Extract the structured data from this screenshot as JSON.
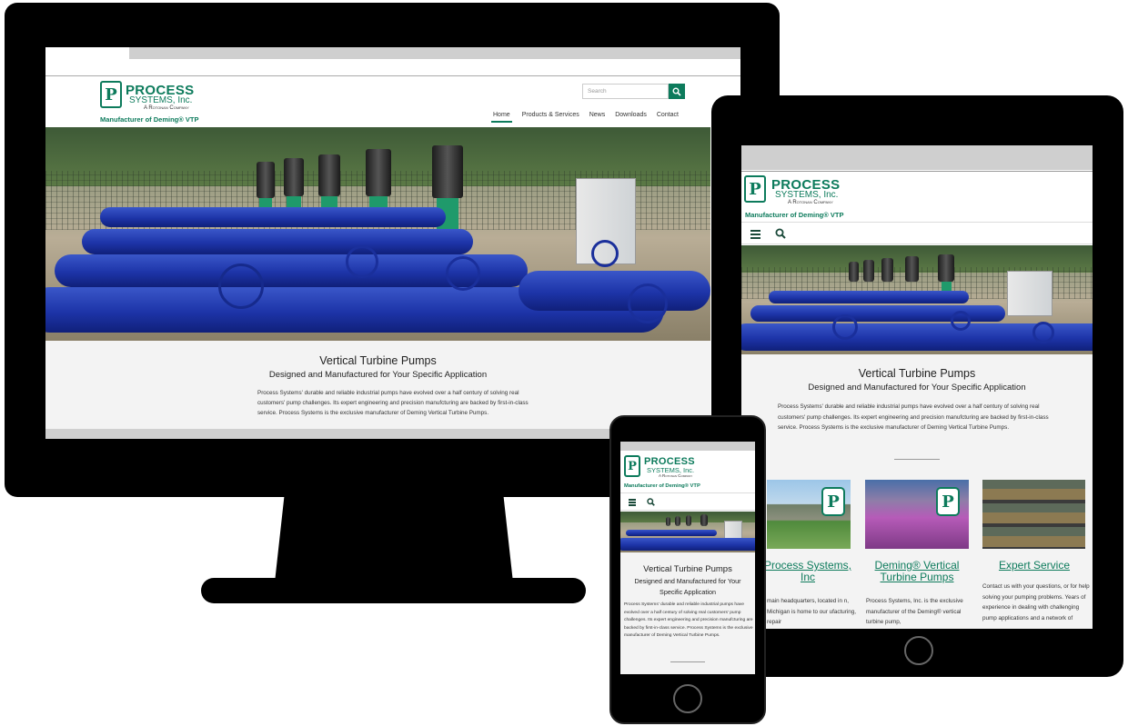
{
  "brand": {
    "logo_word1": "PROCESS",
    "logo_word2": "SYSTEMS, Inc.",
    "logo_word3": "A Rotonan Company",
    "tagline": "Manufacturer of Deming® VTP",
    "accent": "#0d7b5c"
  },
  "desktop": {
    "search_placeholder": "Search",
    "nav": [
      {
        "label": "Home",
        "active": true
      },
      {
        "label": "Products & Services"
      },
      {
        "label": "News"
      },
      {
        "label": "Downloads"
      },
      {
        "label": "Contact"
      }
    ]
  },
  "content": {
    "title": "Vertical Turbine Pumps",
    "subtitle": "Designed and Manufactured for Your Specific Application",
    "body": "Process Systems' durable and reliable industrial pumps have evolved over a half century of solving real customers' pump challenges. Its expert engineering and precision manufcturing are backed by first-in-class service. Process Systems is the exclusive manufacturer of Deming Vertical Turbine Pumps."
  },
  "tiles": [
    {
      "title": "Process Systems, Inc",
      "text": "main headquarters, located in n, Michigan is home to our ufacturing, repair"
    },
    {
      "title": "Deming® Vertical Turbine Pumps",
      "text": "Process Systems, Inc. is the exclusive manufacturer of the Deming® vertical turbine pump,"
    },
    {
      "title": "Expert Service",
      "text": "Contact us with your questions, or for help solving your pumping problems. Years of experience in dealing with challenging pump applications and a network of"
    }
  ],
  "icons": {
    "search": "search-icon",
    "menu": "hamburger-menu-icon"
  }
}
